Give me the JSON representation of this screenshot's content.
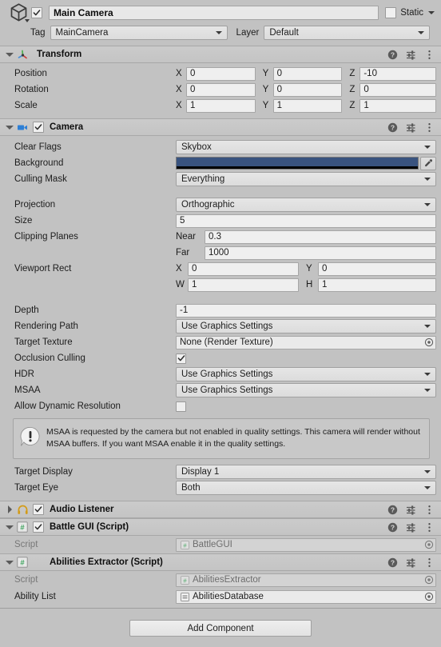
{
  "object_header": {
    "icon": "gameobject-cube-icon",
    "active_checkbox": true,
    "name": "Main Camera",
    "static_label": "Static",
    "static_checked": false,
    "tag_label": "Tag",
    "tag_value": "MainCamera",
    "layer_label": "Layer",
    "layer_value": "Default"
  },
  "header_buttons": {
    "help": "help-icon",
    "preset": "preset-icon",
    "menu": "kebab-menu-icon"
  },
  "components": [
    {
      "id": "transform",
      "title": "Transform",
      "icon": "transform-axis-icon",
      "expanded": true,
      "has_enable_checkbox": false,
      "rows": [
        {
          "type": "vector3",
          "label": "Position",
          "axes": [
            "X",
            "Y",
            "Z"
          ],
          "values": [
            "0",
            "0",
            "-10"
          ]
        },
        {
          "type": "vector3",
          "label": "Rotation",
          "axes": [
            "X",
            "Y",
            "Z"
          ],
          "values": [
            "0",
            "0",
            "0"
          ]
        },
        {
          "type": "vector3",
          "label": "Scale",
          "axes": [
            "X",
            "Y",
            "Z"
          ],
          "values": [
            "1",
            "1",
            "1"
          ]
        }
      ]
    },
    {
      "id": "camera",
      "title": "Camera",
      "icon": "camera-icon",
      "expanded": true,
      "has_enable_checkbox": true,
      "enabled": true,
      "rows": [
        {
          "type": "popup",
          "label": "Clear Flags",
          "value": "Skybox"
        },
        {
          "type": "color",
          "label": "Background",
          "color": "#39537f",
          "alpha_color": "#000000",
          "eyedropper": "eyedropper-icon"
        },
        {
          "type": "popup",
          "label": "Culling Mask",
          "value": "Everything"
        },
        {
          "type": "gap"
        },
        {
          "type": "popup",
          "label": "Projection",
          "value": "Orthographic"
        },
        {
          "type": "text",
          "label": "Size",
          "value": "5"
        },
        {
          "type": "pair",
          "label": "Clipping Planes",
          "sub_label": "Near",
          "value": "0.3"
        },
        {
          "type": "pair",
          "label": "",
          "sub_label": "Far",
          "value": "1000"
        },
        {
          "type": "rect2",
          "label": "Viewport Rect",
          "axes": [
            "X",
            "Y"
          ],
          "values": [
            "0",
            "0"
          ]
        },
        {
          "type": "rect2",
          "label": "",
          "axes": [
            "W",
            "H"
          ],
          "values": [
            "1",
            "1"
          ]
        },
        {
          "type": "gap"
        },
        {
          "type": "text",
          "label": "Depth",
          "value": "-1"
        },
        {
          "type": "popup",
          "label": "Rendering Path",
          "value": "Use Graphics Settings"
        },
        {
          "type": "object",
          "label": "Target Texture",
          "value": "None (Render Texture)",
          "icon": "",
          "disabled": false
        },
        {
          "type": "checkbox",
          "label": "Occlusion Culling",
          "checked": true
        },
        {
          "type": "popup",
          "label": "HDR",
          "value": "Use Graphics Settings"
        },
        {
          "type": "popup",
          "label": "MSAA",
          "value": "Use Graphics Settings"
        },
        {
          "type": "checkbox",
          "label": "Allow Dynamic Resolution",
          "checked": false
        },
        {
          "type": "helpbox",
          "icon": "warning-icon",
          "text": "MSAA is requested by the camera but not enabled in quality settings. This camera will render without MSAA buffers. If you want MSAA enable it in the quality settings."
        },
        {
          "type": "popup",
          "label": "Target Display",
          "value": "Display 1"
        },
        {
          "type": "popup",
          "label": "Target Eye",
          "value": "Both"
        }
      ]
    },
    {
      "id": "audio-listener",
      "title": "Audio Listener",
      "icon": "headphones-icon",
      "expanded": false,
      "has_enable_checkbox": true,
      "enabled": true,
      "rows": []
    },
    {
      "id": "battle-gui",
      "title": "Battle GUI (Script)",
      "icon": "csharp-script-icon",
      "expanded": true,
      "has_enable_checkbox": true,
      "enabled": true,
      "rows": [
        {
          "type": "object",
          "label": "Script",
          "value": "BattleGUI",
          "icon": "csharp-script-icon",
          "disabled": true
        }
      ]
    },
    {
      "id": "abilities-extractor",
      "title": "Abilities Extractor (Script)",
      "icon": "csharp-script-icon",
      "expanded": true,
      "has_enable_checkbox": false,
      "rows": [
        {
          "type": "object",
          "label": "Script",
          "value": "AbilitiesExtractor",
          "icon": "csharp-script-icon",
          "disabled": true
        },
        {
          "type": "object",
          "label": "Ability List",
          "value": "AbilitiesDatabase",
          "icon": "scriptable-object-icon",
          "disabled": false
        }
      ]
    }
  ],
  "add_component": {
    "label": "Add Component"
  }
}
